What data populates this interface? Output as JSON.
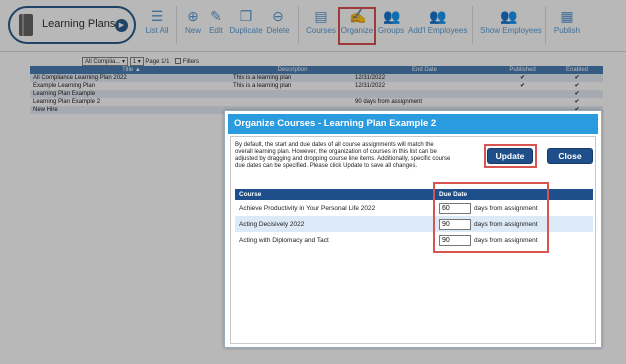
{
  "toolbar": {
    "app_title": "Learning Plans",
    "buttons": [
      {
        "label": "List All",
        "icon": "list-icon"
      },
      {
        "label": "New",
        "icon": "plus-circle-icon"
      },
      {
        "label": "Edit",
        "icon": "pencil-icon"
      },
      {
        "label": "Duplicate",
        "icon": "copy-icon"
      },
      {
        "label": "Delete",
        "icon": "minus-circle-icon"
      },
      {
        "label": "Courses",
        "icon": "courses-icon"
      },
      {
        "label": "Organize",
        "icon": "edit-square-icon"
      },
      {
        "label": "Groups",
        "icon": "groups-icon"
      },
      {
        "label": "Add'l Employees",
        "icon": "add-employees-icon"
      },
      {
        "label": "Show Employees",
        "icon": "employees-icon"
      },
      {
        "label": "Publish",
        "icon": "calendar-check-icon"
      }
    ],
    "highlight_color": "#d9534f"
  },
  "filter": {
    "selected": "All Complia...",
    "page_select": "1",
    "page_text": "Page 1/1",
    "filters_label": "Filters"
  },
  "grid": {
    "columns": [
      "Title",
      "Description",
      "End Date",
      "Published",
      "Enabled"
    ],
    "rows": [
      [
        "All Compliance Learning Plan 2022",
        "This is a learning plan",
        "12/31/2022",
        "✔",
        "✔"
      ],
      [
        "Example Learning Plan",
        "This is a learning plan",
        "12/31/2022",
        "✔",
        "✔"
      ],
      [
        "Learning Plan Example",
        "",
        "",
        "",
        "✔"
      ],
      [
        "Learning Plan Example 2",
        "",
        "90 days from assignment",
        "",
        "✔"
      ],
      [
        "New Hire",
        "",
        "",
        "",
        "✔"
      ]
    ]
  },
  "modal": {
    "title": "Organize Courses - Learning Plan Example 2",
    "instructions": "By default, the start and due dates of all course assignments will match the overall learning plan. However, the organization of courses in this list can be adjusted by dragging and dropping course line items. Additionally, specific course due dates can be specified. Please click Update to save all changes.",
    "update_label": "Update",
    "close_label": "Close",
    "table": {
      "headers": {
        "course": "Course",
        "due": "Due Date"
      },
      "due_suffix": "days from assignment",
      "rows": [
        {
          "course": "Achieve Productivity in Your Personal Life 2022",
          "due": "60"
        },
        {
          "course": "Acting Decisively 2022",
          "due": "90"
        },
        {
          "course": "Acting with Diplomacy and Tact",
          "due": "90"
        }
      ]
    },
    "header_color": "#2b9be0",
    "button_color": "#1f4f8a"
  }
}
